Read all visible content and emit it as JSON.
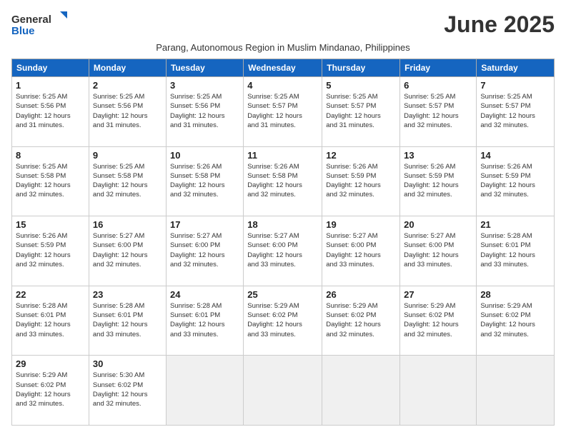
{
  "header": {
    "logo_line1": "General",
    "logo_line2": "Blue",
    "month_title": "June 2025",
    "subtitle": "Parang, Autonomous Region in Muslim Mindanao, Philippines"
  },
  "weekdays": [
    "Sunday",
    "Monday",
    "Tuesday",
    "Wednesday",
    "Thursday",
    "Friday",
    "Saturday"
  ],
  "weeks": [
    [
      {
        "day": "1",
        "info": "Sunrise: 5:25 AM\nSunset: 5:56 PM\nDaylight: 12 hours\nand 31 minutes."
      },
      {
        "day": "2",
        "info": "Sunrise: 5:25 AM\nSunset: 5:56 PM\nDaylight: 12 hours\nand 31 minutes."
      },
      {
        "day": "3",
        "info": "Sunrise: 5:25 AM\nSunset: 5:56 PM\nDaylight: 12 hours\nand 31 minutes."
      },
      {
        "day": "4",
        "info": "Sunrise: 5:25 AM\nSunset: 5:57 PM\nDaylight: 12 hours\nand 31 minutes."
      },
      {
        "day": "5",
        "info": "Sunrise: 5:25 AM\nSunset: 5:57 PM\nDaylight: 12 hours\nand 31 minutes."
      },
      {
        "day": "6",
        "info": "Sunrise: 5:25 AM\nSunset: 5:57 PM\nDaylight: 12 hours\nand 32 minutes."
      },
      {
        "day": "7",
        "info": "Sunrise: 5:25 AM\nSunset: 5:57 PM\nDaylight: 12 hours\nand 32 minutes."
      }
    ],
    [
      {
        "day": "8",
        "info": "Sunrise: 5:25 AM\nSunset: 5:58 PM\nDaylight: 12 hours\nand 32 minutes."
      },
      {
        "day": "9",
        "info": "Sunrise: 5:25 AM\nSunset: 5:58 PM\nDaylight: 12 hours\nand 32 minutes."
      },
      {
        "day": "10",
        "info": "Sunrise: 5:26 AM\nSunset: 5:58 PM\nDaylight: 12 hours\nand 32 minutes."
      },
      {
        "day": "11",
        "info": "Sunrise: 5:26 AM\nSunset: 5:58 PM\nDaylight: 12 hours\nand 32 minutes."
      },
      {
        "day": "12",
        "info": "Sunrise: 5:26 AM\nSunset: 5:59 PM\nDaylight: 12 hours\nand 32 minutes."
      },
      {
        "day": "13",
        "info": "Sunrise: 5:26 AM\nSunset: 5:59 PM\nDaylight: 12 hours\nand 32 minutes."
      },
      {
        "day": "14",
        "info": "Sunrise: 5:26 AM\nSunset: 5:59 PM\nDaylight: 12 hours\nand 32 minutes."
      }
    ],
    [
      {
        "day": "15",
        "info": "Sunrise: 5:26 AM\nSunset: 5:59 PM\nDaylight: 12 hours\nand 32 minutes."
      },
      {
        "day": "16",
        "info": "Sunrise: 5:27 AM\nSunset: 6:00 PM\nDaylight: 12 hours\nand 32 minutes."
      },
      {
        "day": "17",
        "info": "Sunrise: 5:27 AM\nSunset: 6:00 PM\nDaylight: 12 hours\nand 32 minutes."
      },
      {
        "day": "18",
        "info": "Sunrise: 5:27 AM\nSunset: 6:00 PM\nDaylight: 12 hours\nand 33 minutes."
      },
      {
        "day": "19",
        "info": "Sunrise: 5:27 AM\nSunset: 6:00 PM\nDaylight: 12 hours\nand 33 minutes."
      },
      {
        "day": "20",
        "info": "Sunrise: 5:27 AM\nSunset: 6:00 PM\nDaylight: 12 hours\nand 33 minutes."
      },
      {
        "day": "21",
        "info": "Sunrise: 5:28 AM\nSunset: 6:01 PM\nDaylight: 12 hours\nand 33 minutes."
      }
    ],
    [
      {
        "day": "22",
        "info": "Sunrise: 5:28 AM\nSunset: 6:01 PM\nDaylight: 12 hours\nand 33 minutes."
      },
      {
        "day": "23",
        "info": "Sunrise: 5:28 AM\nSunset: 6:01 PM\nDaylight: 12 hours\nand 33 minutes."
      },
      {
        "day": "24",
        "info": "Sunrise: 5:28 AM\nSunset: 6:01 PM\nDaylight: 12 hours\nand 33 minutes."
      },
      {
        "day": "25",
        "info": "Sunrise: 5:29 AM\nSunset: 6:02 PM\nDaylight: 12 hours\nand 33 minutes."
      },
      {
        "day": "26",
        "info": "Sunrise: 5:29 AM\nSunset: 6:02 PM\nDaylight: 12 hours\nand 32 minutes."
      },
      {
        "day": "27",
        "info": "Sunrise: 5:29 AM\nSunset: 6:02 PM\nDaylight: 12 hours\nand 32 minutes."
      },
      {
        "day": "28",
        "info": "Sunrise: 5:29 AM\nSunset: 6:02 PM\nDaylight: 12 hours\nand 32 minutes."
      }
    ],
    [
      {
        "day": "29",
        "info": "Sunrise: 5:29 AM\nSunset: 6:02 PM\nDaylight: 12 hours\nand 32 minutes."
      },
      {
        "day": "30",
        "info": "Sunrise: 5:30 AM\nSunset: 6:02 PM\nDaylight: 12 hours\nand 32 minutes."
      },
      {
        "day": "",
        "info": ""
      },
      {
        "day": "",
        "info": ""
      },
      {
        "day": "",
        "info": ""
      },
      {
        "day": "",
        "info": ""
      },
      {
        "day": "",
        "info": ""
      }
    ]
  ]
}
